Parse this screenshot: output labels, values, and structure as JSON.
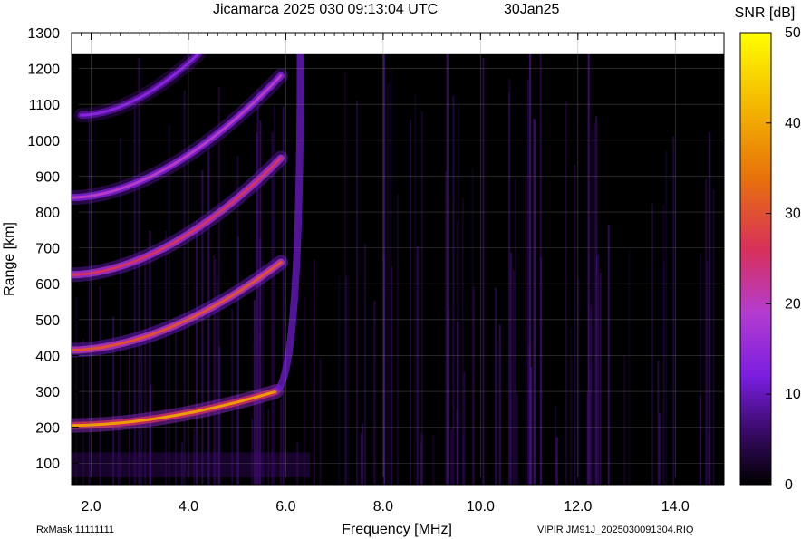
{
  "chart_data": {
    "type": "heatmap",
    "title": "Jicamarca 2025 030 09:13:04 UTC",
    "date_label": "30Jan25",
    "xlabel": "Frequency [MHz]",
    "ylabel": "Range [km]",
    "xlim": [
      1.6,
      15.0
    ],
    "ylim": [
      40,
      1300
    ],
    "data_range_top_km": 1240,
    "x_ticks": [
      "2.0",
      "4.0",
      "6.0",
      "8.0",
      "10.0",
      "12.0",
      "14.0"
    ],
    "x_tick_values": [
      2,
      4,
      6,
      8,
      10,
      12,
      14
    ],
    "y_ticks": [
      "100",
      "200",
      "300",
      "400",
      "500",
      "600",
      "700",
      "800",
      "900",
      "1000",
      "1100",
      "1200",
      "1300"
    ],
    "y_tick_values": [
      100,
      200,
      300,
      400,
      500,
      600,
      700,
      800,
      900,
      1000,
      1100,
      1200,
      1300
    ],
    "grid": true,
    "colorbar": {
      "label": "SNR [dB]",
      "min": 0,
      "max": 50,
      "ticks": [
        "0",
        "10",
        "20",
        "30",
        "40",
        "50"
      ],
      "tick_values": [
        0,
        10,
        20,
        30,
        40,
        50
      ],
      "colormap": [
        "#000000",
        "#3a0a6a",
        "#7a1ee0",
        "#b43cd0",
        "#d8305a",
        "#e8720a",
        "#f4b800",
        "#ffff00"
      ]
    },
    "traces": [
      {
        "hop": 1,
        "f_start": 1.6,
        "f_end": 5.8,
        "h_start": 205,
        "h_end": 300,
        "f_cusp": 6.3,
        "snr_peak": 40
      },
      {
        "hop": 2,
        "f_start": 1.6,
        "f_end": 5.9,
        "h_start": 415,
        "h_end": 660,
        "snr_peak": 32
      },
      {
        "hop": 3,
        "f_start": 1.6,
        "f_end": 5.9,
        "h_start": 625,
        "h_end": 950,
        "snr_peak": 28
      },
      {
        "hop": 4,
        "f_start": 1.6,
        "f_end": 5.9,
        "h_start": 840,
        "h_end": 1180,
        "snr_peak": 22
      },
      {
        "hop": 5,
        "f_start": 1.8,
        "f_end": 4.2,
        "h_start": 1070,
        "h_end": 1240,
        "snr_peak": 16
      }
    ]
  },
  "footer": {
    "rxmask": "RxMask 11111111",
    "file": "VIPIR  JM91J_2025030091304.RIQ"
  }
}
